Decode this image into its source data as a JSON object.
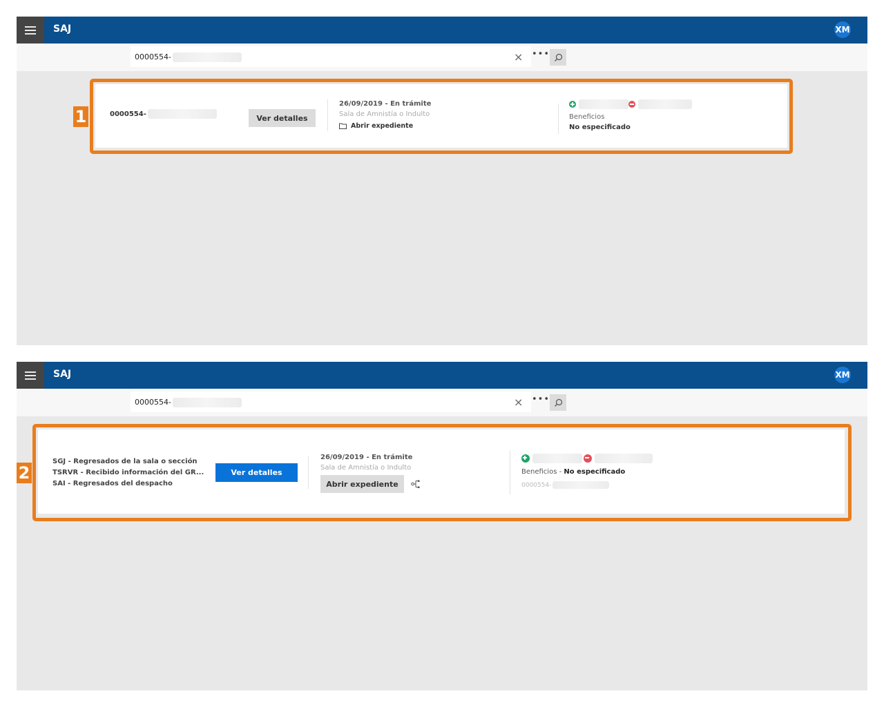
{
  "app": {
    "title": "SAJ",
    "user_initials": "XM",
    "colors": {
      "topbar": "#0a4f8e",
      "highlight": "#e87d1e",
      "primary_button": "#0a73d9"
    }
  },
  "icons": {
    "menu": "hamburger-icon",
    "clear": "close-icon",
    "more": "more-dots-icon",
    "search": "search-icon",
    "folder": "folder-icon",
    "tree": "tree-icon",
    "add": "plus-circle-icon",
    "remove": "minus-circle-icon"
  },
  "top": {
    "search_value": "0000554-",
    "clear_label": "×",
    "more_label": "•••",
    "badge": "1",
    "card": {
      "case_number": "0000554-",
      "details_label": "Ver detalles",
      "date_status": "26/09/2019 - En trámite",
      "sala": "Sala de Amnistía o Indulto",
      "open_label": "Abrir expediente",
      "benefits_label": "Beneficios",
      "benefits_value": "No especificado"
    }
  },
  "bottom": {
    "search_value": "0000554-",
    "clear_label": "×",
    "more_label": "•••",
    "badge": "2",
    "card": {
      "status_lines": [
        "SGJ - Regresados de la sala o sección",
        "TSRVR - Recibido información del GR...",
        "SAI - Regresados del despacho"
      ],
      "details_label": "Ver detalles",
      "date_status": "26/09/2019 - En trámite",
      "sala": "Sala de Amnistía o Indulto",
      "open_label": "Abrir expediente",
      "benefits_label": "Beneficios - ",
      "benefits_value": "No especificado",
      "case_number": "0000554-"
    }
  }
}
